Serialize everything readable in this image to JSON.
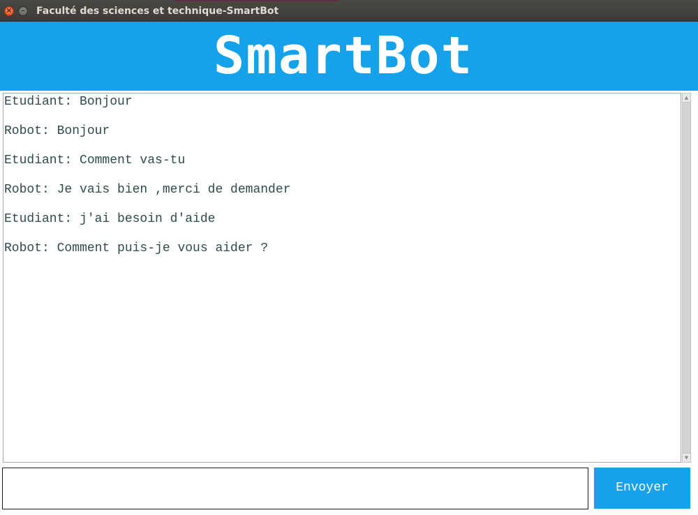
{
  "window": {
    "title": "Faculté des sciences et technique-SmartBot",
    "close_glyph": "×",
    "minimize_glyph": "–"
  },
  "header": {
    "logo_text": "SmartBot",
    "background_color": "#16a2eb"
  },
  "chat": {
    "messages": [
      {
        "text": "Etudiant: Bonjour"
      },
      {
        "text": "Robot: Bonjour"
      },
      {
        "text": "Etudiant: Comment vas-tu"
      },
      {
        "text": "Robot: Je vais bien ,merci de demander"
      },
      {
        "text": "Etudiant: j'ai besoin d'aide"
      },
      {
        "text": "Robot: Comment puis-je vous aider ?"
      }
    ],
    "text_color": "#2f4b4b"
  },
  "scrollbar": {
    "up_arrow": "▲",
    "down_arrow": "▼"
  },
  "input": {
    "value": "",
    "placeholder": ""
  },
  "send": {
    "label": "Envoyer",
    "color": "#16a2eb"
  }
}
